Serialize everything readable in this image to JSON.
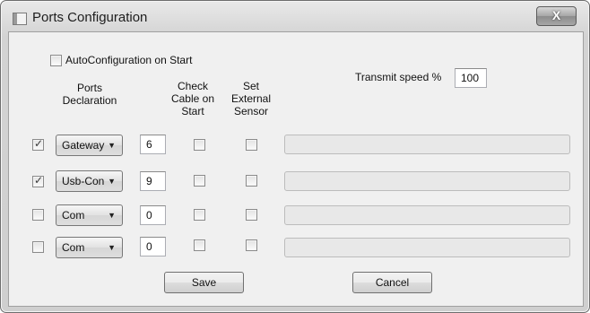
{
  "window": {
    "title": "Ports Configuration",
    "close_label": "X"
  },
  "autoconfig": {
    "label": "AutoConfiguration on Start",
    "checked": false
  },
  "headers": {
    "ports_declaration": "Ports\nDeclaration",
    "check_cable": "Check\nCable on\nStart",
    "set_external": "Set\nExternal\nSensor"
  },
  "transmit": {
    "label": "Transmit speed %",
    "value": "100"
  },
  "rows": [
    {
      "enabled": true,
      "port": "Gateway",
      "number": "6",
      "check_cable": false,
      "external_sensor": false
    },
    {
      "enabled": true,
      "port": "Usb-Con",
      "number": "9",
      "check_cable": false,
      "external_sensor": false
    },
    {
      "enabled": false,
      "port": "Com",
      "number": "0",
      "check_cable": false,
      "external_sensor": false
    },
    {
      "enabled": false,
      "port": "Com",
      "number": "0",
      "check_cable": false,
      "external_sensor": false
    }
  ],
  "buttons": {
    "save": "Save",
    "cancel": "Cancel"
  }
}
